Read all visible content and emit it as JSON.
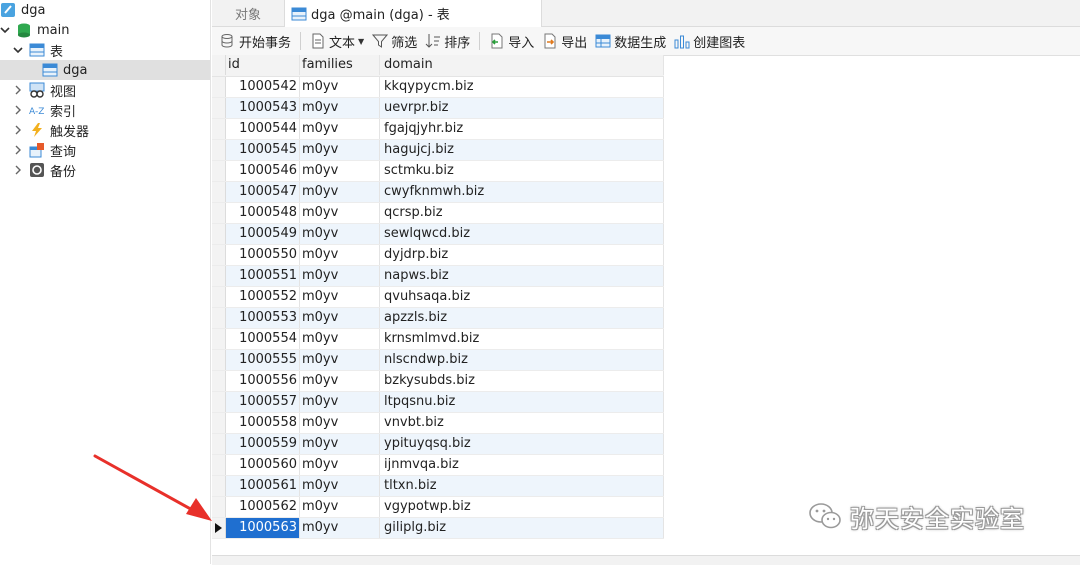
{
  "tree": {
    "items": [
      {
        "label": "dga"
      },
      {
        "label": "main"
      },
      {
        "label": "表"
      },
      {
        "label": "dga"
      },
      {
        "label": "视图"
      },
      {
        "label": "索引"
      },
      {
        "label": "触发器"
      },
      {
        "label": "查询"
      },
      {
        "label": "备份"
      }
    ]
  },
  "tabs": {
    "objects_label": "对象",
    "active_label": "dga @main (dga) - 表"
  },
  "toolbar": {
    "begin_transaction": "开始事务",
    "text": "文本",
    "filter": "筛选",
    "sort": "排序",
    "import": "导入",
    "export": "导出",
    "data_generation": "数据生成",
    "create_chart": "创建图表"
  },
  "grid": {
    "columns": [
      "id",
      "families",
      "domain"
    ],
    "rows": [
      [
        "1000542",
        "m0yv",
        "kkqypycm.biz"
      ],
      [
        "1000543",
        "m0yv",
        "uevrpr.biz"
      ],
      [
        "1000544",
        "m0yv",
        "fgajqjyhr.biz"
      ],
      [
        "1000545",
        "m0yv",
        "hagujcj.biz"
      ],
      [
        "1000546",
        "m0yv",
        "sctmku.biz"
      ],
      [
        "1000547",
        "m0yv",
        "cwyfknmwh.biz"
      ],
      [
        "1000548",
        "m0yv",
        "qcrsp.biz"
      ],
      [
        "1000549",
        "m0yv",
        "sewlqwcd.biz"
      ],
      [
        "1000550",
        "m0yv",
        "dyjdrp.biz"
      ],
      [
        "1000551",
        "m0yv",
        "napws.biz"
      ],
      [
        "1000552",
        "m0yv",
        "qvuhsaqa.biz"
      ],
      [
        "1000553",
        "m0yv",
        "apzzls.biz"
      ],
      [
        "1000554",
        "m0yv",
        "krnsmlmvd.biz"
      ],
      [
        "1000555",
        "m0yv",
        "nlscndwp.biz"
      ],
      [
        "1000556",
        "m0yv",
        "bzkysubds.biz"
      ],
      [
        "1000557",
        "m0yv",
        "ltpqsnu.biz"
      ],
      [
        "1000558",
        "m0yv",
        "vnvbt.biz"
      ],
      [
        "1000559",
        "m0yv",
        "ypituyqsq.biz"
      ],
      [
        "1000560",
        "m0yv",
        "ijnmvqa.biz"
      ],
      [
        "1000561",
        "m0yv",
        "tltxn.biz"
      ],
      [
        "1000562",
        "m0yv",
        "vgypotwp.biz"
      ],
      [
        "1000563",
        "m0yv",
        "giliplg.biz"
      ]
    ],
    "selected_row": 21
  },
  "watermark": {
    "text": "弥天安全实验室"
  },
  "colors": {
    "selection": "#1f6fd0",
    "alt_row": "#eef5fc",
    "tree_selected": "#e0e0e0",
    "arrow": "#e8302a"
  }
}
